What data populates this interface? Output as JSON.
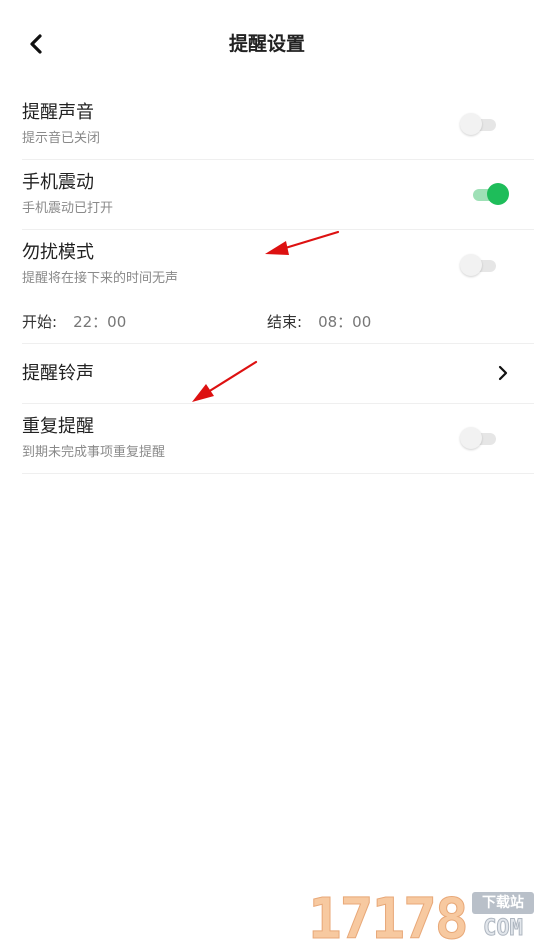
{
  "header": {
    "title": "提醒设置",
    "back_icon": "chevron-left-icon"
  },
  "settings": {
    "sound": {
      "title": "提醒声音",
      "subtitle": "提示音已关闭",
      "enabled": false
    },
    "vibration": {
      "title": "手机震动",
      "subtitle": "手机震动已打开",
      "enabled": true
    },
    "dnd": {
      "title": "勿扰模式",
      "subtitle": "提醒将在接下来的时间无声",
      "enabled": false,
      "start_label": "开始:",
      "start_value": "22：00",
      "end_label": "结束:",
      "end_value": "08：00"
    },
    "ringtone": {
      "title": "提醒铃声",
      "chevron_icon": "chevron-right-icon"
    },
    "repeat": {
      "title": "重复提醒",
      "subtitle": "到期未完成事项重复提醒",
      "enabled": false
    }
  },
  "colors": {
    "toggle_on": "#1ebd5a",
    "toggle_off": "#e6e6e6",
    "annotation_arrow": "#dd1111"
  },
  "watermark": {
    "digits": "17178",
    "badge": "下载站",
    "suffix": "COM"
  }
}
